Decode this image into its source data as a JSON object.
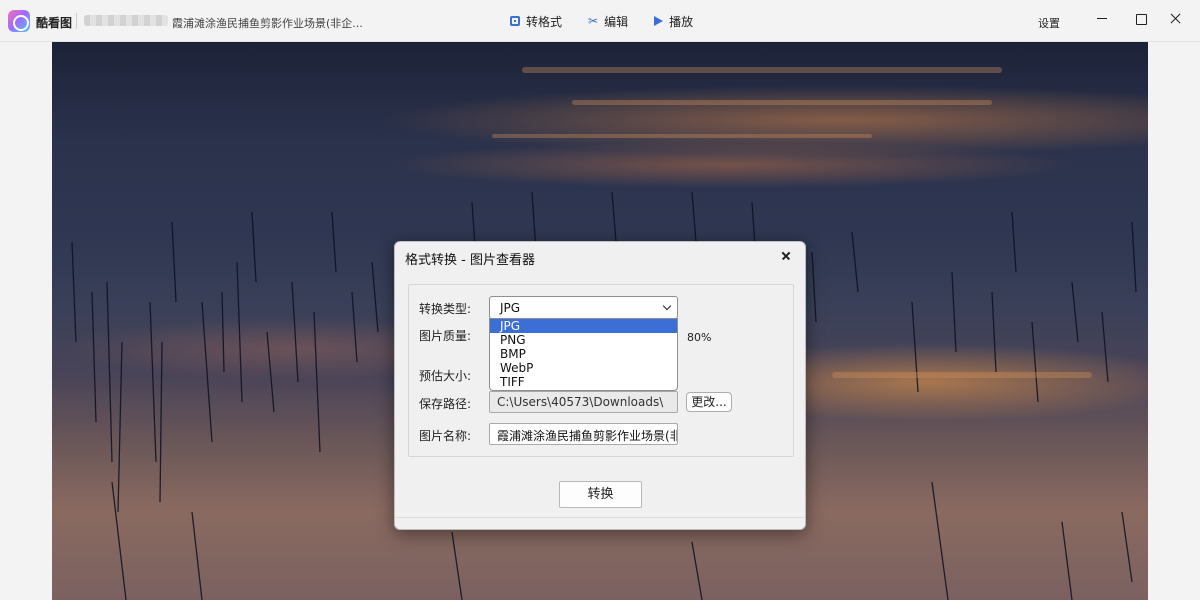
{
  "app": {
    "name": "酷看图",
    "file_title": "霞浦滩涂渔民捕鱼剪影作业场景(非企..."
  },
  "toolbar": {
    "convert_label": "转格式",
    "edit_label": "编辑",
    "play_label": "播放"
  },
  "window": {
    "settings_label": "设置"
  },
  "dialog": {
    "title": "格式转换 - 图片查看器",
    "type_label": "转换类型:",
    "quality_label": "图片质量:",
    "quality_value": "80%",
    "size_label": "预估大小:",
    "path_label": "保存路径:",
    "path_value": "C:\\Users\\40573\\Downloads\\",
    "change_button": "更改...",
    "name_label": "图片名称:",
    "name_value": "霞浦滩涂渔民捕鱼剪影作业场景(非",
    "convert_button": "转换",
    "format_select": {
      "selected": "JPG",
      "options": [
        "JPG",
        "PNG",
        "BMP",
        "WebP",
        "TIFF"
      ]
    }
  },
  "colors": {
    "accent": "#3b6fd6",
    "dialog_bg": "#f0f0f0"
  }
}
